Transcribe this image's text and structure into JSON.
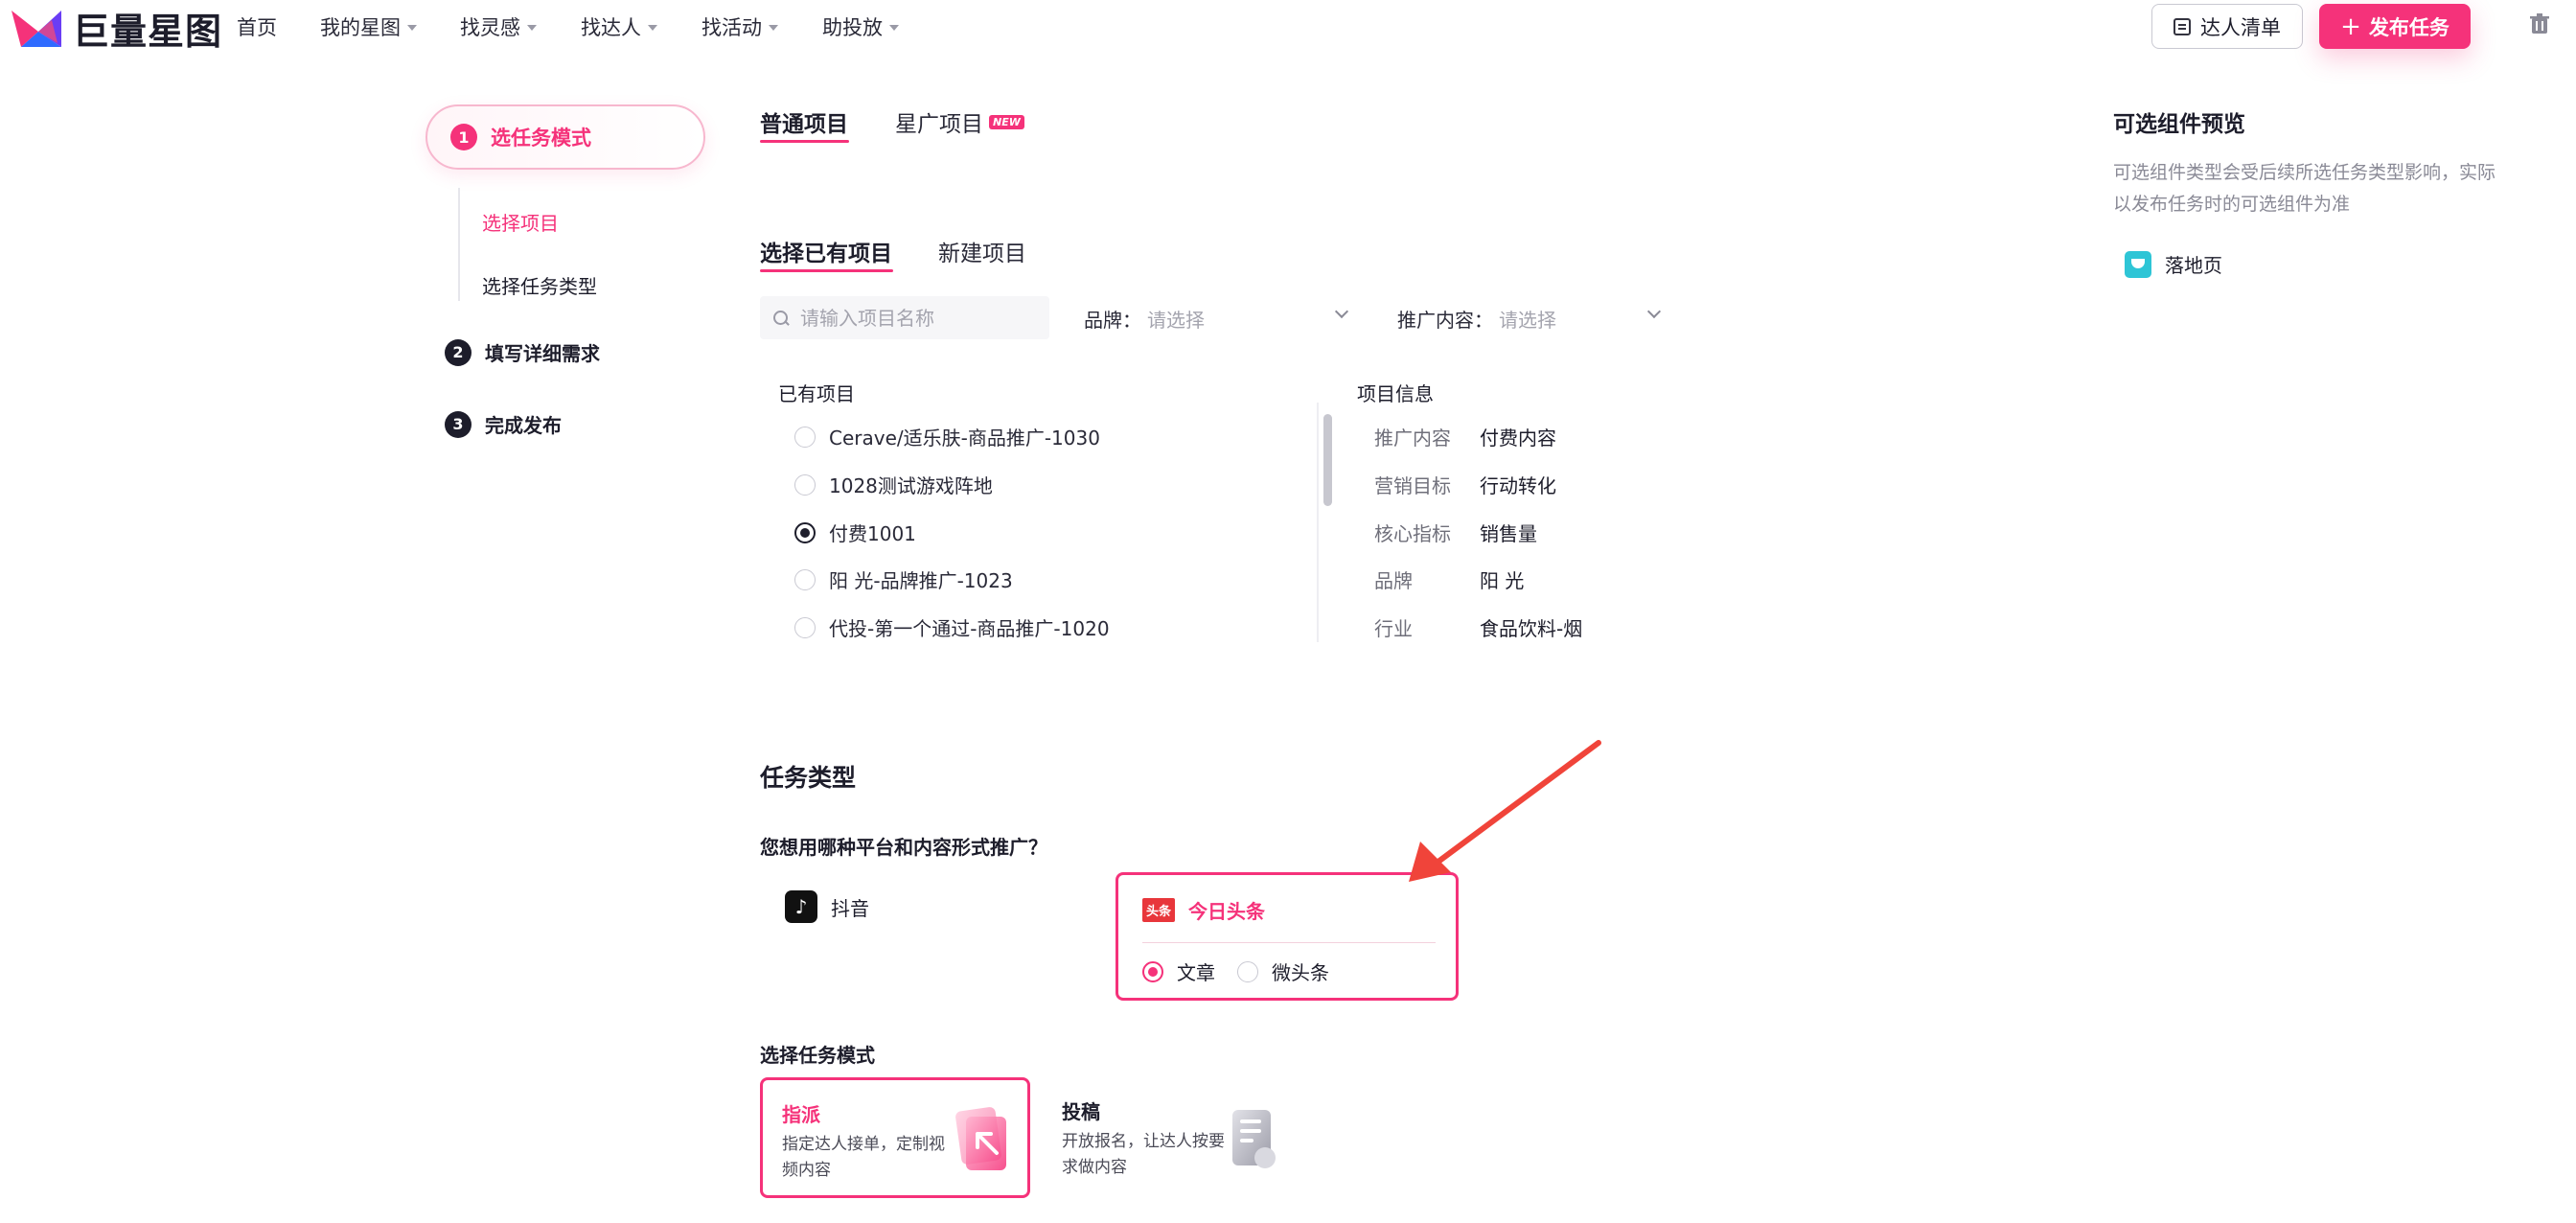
{
  "app": {
    "logo_text": "巨量星图"
  },
  "nav": {
    "items": [
      {
        "label": "首页",
        "has_caret": false
      },
      {
        "label": "我的星图",
        "has_caret": true
      },
      {
        "label": "找灵感",
        "has_caret": true
      },
      {
        "label": "找达人",
        "has_caret": true
      },
      {
        "label": "找活动",
        "has_caret": true
      },
      {
        "label": "助投放",
        "has_caret": true
      }
    ],
    "list_button": "达人清单",
    "publish_button": "发布任务"
  },
  "steps": {
    "step1": {
      "num": "1",
      "label": "选任务模式"
    },
    "substeps": [
      "选择项目",
      "选择任务类型"
    ],
    "step2": {
      "num": "2",
      "label": "填写详细需求"
    },
    "step3": {
      "num": "3",
      "label": "完成发布"
    }
  },
  "tabs": {
    "primary": [
      "普通项目",
      "星广项目"
    ],
    "new_badge": "NEW",
    "secondary": [
      "选择已有项目",
      "新建项目"
    ]
  },
  "filters": {
    "search_placeholder": "请输入项目名称",
    "brand_label": "品牌：",
    "brand_placeholder": "请选择",
    "content_label": "推广内容：",
    "content_placeholder": "请选择"
  },
  "projects": {
    "header": "已有项目",
    "items": [
      {
        "name": "Cerave/适乐肤-商品推广-1030",
        "selected": false
      },
      {
        "name": "1028测试游戏阵地",
        "selected": false
      },
      {
        "name": "付费1001",
        "selected": true
      },
      {
        "name": "阳 光-品牌推广-1023",
        "selected": false
      },
      {
        "name": "代投-第一个通过-商品推广-1020",
        "selected": false
      }
    ]
  },
  "project_info": {
    "header": "项目信息",
    "rows": [
      {
        "k": "推广内容",
        "v": "付费内容"
      },
      {
        "k": "营销目标",
        "v": "行动转化"
      },
      {
        "k": "核心指标",
        "v": "销售量"
      },
      {
        "k": "品牌",
        "v": "阳 光"
      },
      {
        "k": "行业",
        "v": "食品饮料-烟"
      }
    ]
  },
  "task_type": {
    "title": "任务类型",
    "question": "您想用哪种平台和内容形式推广？",
    "douyin": "抖音",
    "toutiao": {
      "badge": "头条",
      "label": "今日头条",
      "options": [
        {
          "label": "文章",
          "selected": true
        },
        {
          "label": "微头条",
          "selected": false
        }
      ]
    }
  },
  "task_mode": {
    "title": "选择任务模式",
    "cards": [
      {
        "title": "指派",
        "desc": "指定达人接单，定制视频内容",
        "selected": true
      },
      {
        "title": "投稿",
        "desc": "开放报名，让达人按要求做内容",
        "selected": false
      }
    ]
  },
  "preview": {
    "title": "可选组件预览",
    "desc": "可选组件类型会受后续所选任务类型影响，实际以发布任务时的可选组件为准",
    "component": "落地页"
  },
  "colors": {
    "accent": "#f5327a",
    "dark": "#1d1d2b",
    "toutiao_red": "#e8363b",
    "landing_cyan": "#2ec5d6"
  }
}
